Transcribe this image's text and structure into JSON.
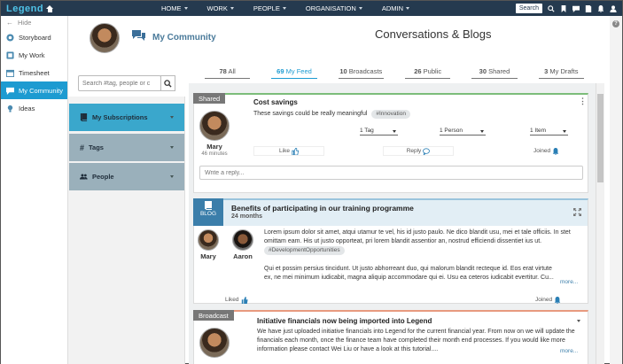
{
  "app": {
    "brand": "Legend"
  },
  "nav": {
    "items": [
      "HOME",
      "WORK",
      "PEOPLE",
      "ORGANISATION",
      "ADMIN"
    ],
    "search_label": "Search"
  },
  "sidebar": {
    "hide_label": "Hide",
    "items": [
      {
        "label": "Storyboard",
        "icon": "storyboard-icon"
      },
      {
        "label": "My Work",
        "icon": "mywork-icon"
      },
      {
        "label": "Timesheet",
        "icon": "calendar-icon"
      },
      {
        "label": "My Community",
        "icon": "chat-icon",
        "active": true
      },
      {
        "label": "Ideas",
        "icon": "lightbulb-icon"
      }
    ]
  },
  "header": {
    "section_title": "My Community",
    "page_title": "Conversations & Blogs"
  },
  "filters": {
    "search_placeholder": "Search #tag, people or c",
    "panels": [
      {
        "label": "My Subscriptions",
        "icon": "book-icon"
      },
      {
        "label": "Tags",
        "icon": "hash-icon"
      },
      {
        "label": "People",
        "icon": "people-icon"
      }
    ]
  },
  "tabs": [
    {
      "num": "78",
      "label": "All"
    },
    {
      "num": "69",
      "label": "My Feed",
      "active": true
    },
    {
      "num": "10",
      "label": "Broadcasts"
    },
    {
      "num": "26",
      "label": "Public"
    },
    {
      "num": "30",
      "label": "Shared"
    },
    {
      "num": "3",
      "label": "My Drafts"
    }
  ],
  "posts": {
    "shared": {
      "badge": "Shared",
      "title": "Cost savings",
      "text": "These savings could be really meaningful",
      "tag": "#Innovation",
      "author": "Mary",
      "time": "46 minutes",
      "dropdowns": [
        "1 Tag",
        "1 Person",
        "1 Item"
      ],
      "like": "Like",
      "reply": "Reply",
      "joined": "Joined",
      "reply_placeholder": "Write a reply..."
    },
    "blog": {
      "badge": "BLOG",
      "title": "Benefits of participating in our training programme",
      "subtitle": "24 months",
      "para1": "Lorem ipsum dolor sit amet, atqui utamur te vel, his id justo paulo. Ne dico blandit usu, mei et tale officiis. In stet omittam eam. His ut justo opporteat, pri lorem blandit assentior an, nostrud efficiendi dissentiet ius ut.",
      "tag": "#DevelopmentOpportunities",
      "para2": "Qui et possim persius tincidunt. Ut justo abhorreant duo, qui malorum blandit recteque id. Eos erat virtute ex, ne mei minimum iudicabit, magna aliquip accommodare qui ei. Usu ea ceteros iudicabit evertitur. Cu...",
      "people": [
        "Mary",
        "Aaron"
      ],
      "liked": "Liked",
      "joined": "Joined",
      "more": "more..."
    },
    "broadcast": {
      "badge": "Broadcast",
      "title": "Initiative financials now being imported into Legend",
      "text": "We have just uploaded initiative financials into Legend for the current financial year. From now on we will update the financials each month, once the finance team have completed their month end processes.  If you would like more information please contact Wei Liu or have a look at this tutorial....",
      "more": "more..."
    }
  }
}
